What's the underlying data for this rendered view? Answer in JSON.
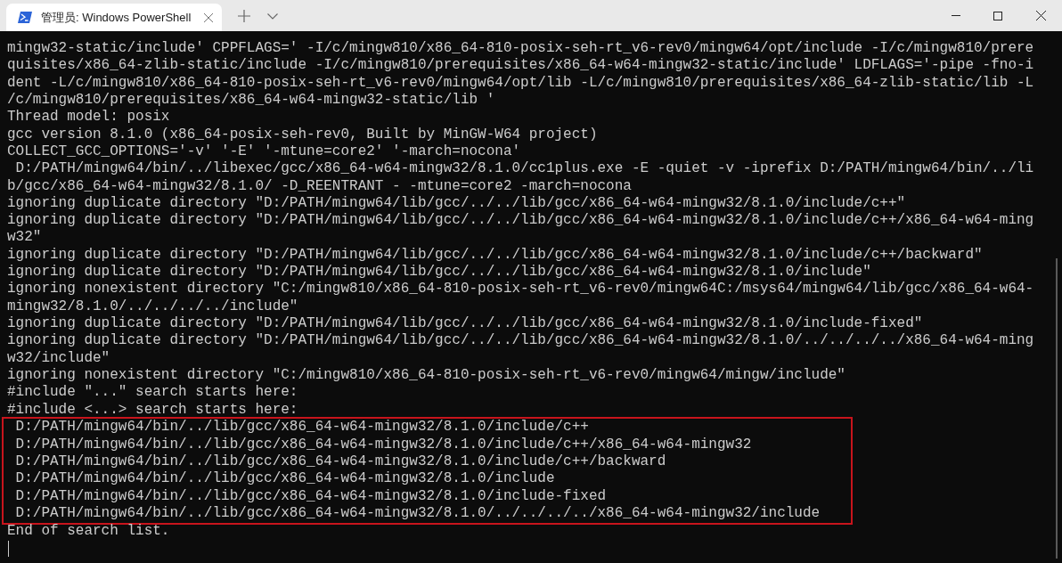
{
  "tabs": [
    {
      "title": "管理员: Windows PowerShell",
      "selected": true
    }
  ],
  "terminal": {
    "lines": [
      {
        "text": "mingw32-static/include' CPPFLAGS=' -I/c/mingw810/x86_64-810-posix-seh-rt_v6-rev0/mingw64/opt/include -I/c/mingw810/prere",
        "highlighted": false
      },
      {
        "text": "quisites/x86_64-zlib-static/include -I/c/mingw810/prerequisites/x86_64-w64-mingw32-static/include' LDFLAGS='-pipe -fno-i",
        "highlighted": false
      },
      {
        "text": "dent -L/c/mingw810/x86_64-810-posix-seh-rt_v6-rev0/mingw64/opt/lib -L/c/mingw810/prerequisites/x86_64-zlib-static/lib -L",
        "highlighted": false
      },
      {
        "text": "/c/mingw810/prerequisites/x86_64-w64-mingw32-static/lib '",
        "highlighted": false
      },
      {
        "text": "Thread model: posix",
        "highlighted": false
      },
      {
        "text": "gcc version 8.1.0 (x86_64-posix-seh-rev0, Built by MinGW-W64 project)",
        "highlighted": false
      },
      {
        "text": "COLLECT_GCC_OPTIONS='-v' '-E' '-mtune=core2' '-march=nocona'",
        "highlighted": false
      },
      {
        "text": " D:/PATH/mingw64/bin/../libexec/gcc/x86_64-w64-mingw32/8.1.0/cc1plus.exe -E -quiet -v -iprefix D:/PATH/mingw64/bin/../li",
        "highlighted": false
      },
      {
        "text": "b/gcc/x86_64-w64-mingw32/8.1.0/ -D_REENTRANT - -mtune=core2 -march=nocona",
        "highlighted": false
      },
      {
        "text": "ignoring duplicate directory \"D:/PATH/mingw64/lib/gcc/../../lib/gcc/x86_64-w64-mingw32/8.1.0/include/c++\"",
        "highlighted": false
      },
      {
        "text": "ignoring duplicate directory \"D:/PATH/mingw64/lib/gcc/../../lib/gcc/x86_64-w64-mingw32/8.1.0/include/c++/x86_64-w64-ming",
        "highlighted": false
      },
      {
        "text": "w32\"",
        "highlighted": false
      },
      {
        "text": "ignoring duplicate directory \"D:/PATH/mingw64/lib/gcc/../../lib/gcc/x86_64-w64-mingw32/8.1.0/include/c++/backward\"",
        "highlighted": false
      },
      {
        "text": "ignoring duplicate directory \"D:/PATH/mingw64/lib/gcc/../../lib/gcc/x86_64-w64-mingw32/8.1.0/include\"",
        "highlighted": false
      },
      {
        "text": "ignoring nonexistent directory \"C:/mingw810/x86_64-810-posix-seh-rt_v6-rev0/mingw64C:/msys64/mingw64/lib/gcc/x86_64-w64-",
        "highlighted": false
      },
      {
        "text": "mingw32/8.1.0/../../../../include\"",
        "highlighted": false
      },
      {
        "text": "ignoring duplicate directory \"D:/PATH/mingw64/lib/gcc/../../lib/gcc/x86_64-w64-mingw32/8.1.0/include-fixed\"",
        "highlighted": false
      },
      {
        "text": "ignoring duplicate directory \"D:/PATH/mingw64/lib/gcc/../../lib/gcc/x86_64-w64-mingw32/8.1.0/../../../../x86_64-w64-ming",
        "highlighted": false
      },
      {
        "text": "w32/include\"",
        "highlighted": false
      },
      {
        "text": "ignoring nonexistent directory \"C:/mingw810/x86_64-810-posix-seh-rt_v6-rev0/mingw64/mingw/include\"",
        "highlighted": false
      },
      {
        "text": "#include \"...\" search starts here:",
        "highlighted": false
      },
      {
        "text": "#include <...> search starts here:",
        "highlighted": false
      },
      {
        "text": " D:/PATH/mingw64/bin/../lib/gcc/x86_64-w64-mingw32/8.1.0/include/c++",
        "highlighted": true
      },
      {
        "text": " D:/PATH/mingw64/bin/../lib/gcc/x86_64-w64-mingw32/8.1.0/include/c++/x86_64-w64-mingw32",
        "highlighted": true
      },
      {
        "text": " D:/PATH/mingw64/bin/../lib/gcc/x86_64-w64-mingw32/8.1.0/include/c++/backward",
        "highlighted": true
      },
      {
        "text": " D:/PATH/mingw64/bin/../lib/gcc/x86_64-w64-mingw32/8.1.0/include",
        "highlighted": true
      },
      {
        "text": " D:/PATH/mingw64/bin/../lib/gcc/x86_64-w64-mingw32/8.1.0/include-fixed",
        "highlighted": true
      },
      {
        "text": " D:/PATH/mingw64/bin/../lib/gcc/x86_64-w64-mingw32/8.1.0/../../../../x86_64-w64-mingw32/include",
        "highlighted": true
      },
      {
        "text": "End of search list.",
        "highlighted": false
      }
    ]
  }
}
